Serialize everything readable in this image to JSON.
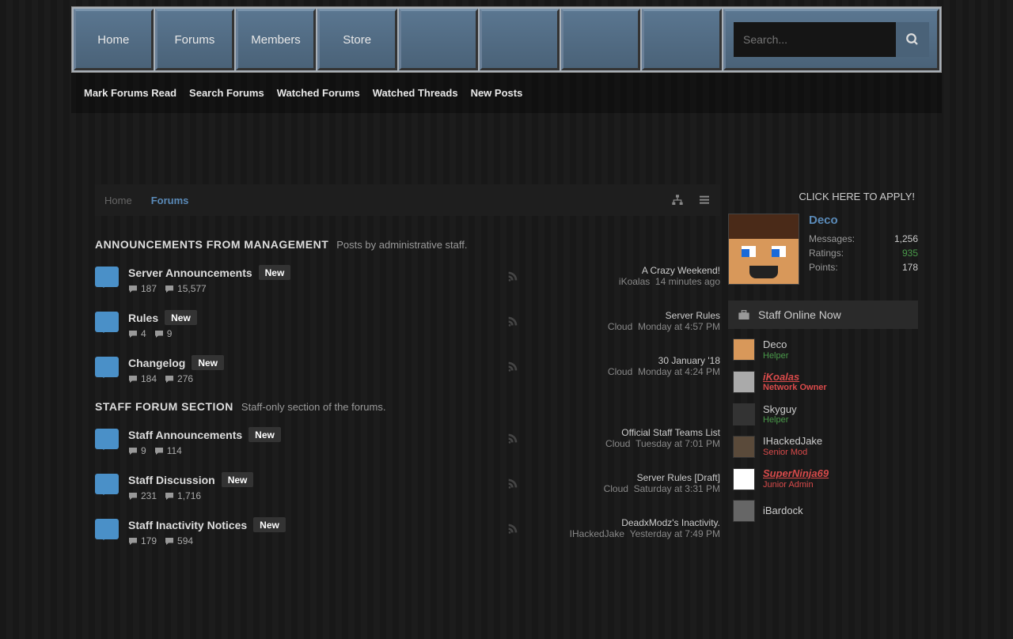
{
  "nav": {
    "items": [
      "Home",
      "Forums",
      "Members",
      "Store"
    ],
    "search_placeholder": "Search..."
  },
  "subnav": [
    "Mark Forums Read",
    "Search Forums",
    "Watched Forums",
    "Watched Threads",
    "New Posts"
  ],
  "breadcrumb": {
    "home": "Home",
    "current": "Forums"
  },
  "new_label": "New",
  "sections": [
    {
      "title": "ANNOUNCEMENTS FROM MANAGEMENT",
      "subtitle": "Posts by administrative staff.",
      "forums": [
        {
          "name": "Server Announcements",
          "threads": "187",
          "posts": "15,577",
          "latest_title": "A Crazy Weekend!",
          "latest_user": "iKoalas",
          "latest_time": "14 minutes ago"
        },
        {
          "name": "Rules",
          "threads": "4",
          "posts": "9",
          "latest_title": "Server Rules",
          "latest_user": "Cloud",
          "latest_time": "Monday at 4:57 PM"
        },
        {
          "name": "Changelog",
          "threads": "184",
          "posts": "276",
          "latest_title": "30 January '18",
          "latest_user": "Cloud",
          "latest_time": "Monday at 4:24 PM"
        }
      ]
    },
    {
      "title": "STAFF FORUM SECTION",
      "subtitle": "Staff-only section of the forums.",
      "forums": [
        {
          "name": "Staff Announcements",
          "threads": "9",
          "posts": "114",
          "latest_title": "Official Staff Teams List",
          "latest_user": "Cloud",
          "latest_time": "Tuesday at 7:01 PM"
        },
        {
          "name": "Staff Discussion",
          "threads": "231",
          "posts": "1,716",
          "latest_title": "Server Rules [Draft]",
          "latest_user": "Cloud",
          "latest_time": "Saturday at 3:31 PM"
        },
        {
          "name": "Staff Inactivity Notices",
          "threads": "179",
          "posts": "594",
          "latest_title": "DeadxModz's Inactivity.",
          "latest_user": "IHackedJake",
          "latest_time": "Yesterday at 7:49 PM"
        }
      ]
    }
  ],
  "sidebar": {
    "apply": "CLICK HERE TO APPLY!",
    "profile": {
      "name": "Deco",
      "stats": [
        {
          "label": "Messages:",
          "value": "1,256",
          "cls": ""
        },
        {
          "label": "Ratings:",
          "value": "935",
          "cls": "green"
        },
        {
          "label": "Points:",
          "value": "178",
          "cls": ""
        }
      ]
    },
    "staff_header": "Staff Online Now",
    "staff": [
      {
        "name": "Deco",
        "role": "Helper",
        "nameCls": "",
        "roleCls": "role-helper",
        "av": "#d8985a"
      },
      {
        "name": "iKoalas",
        "role": "Network Owner",
        "nameCls": "name-owner",
        "roleCls": "role-owner",
        "av": "#aaa"
      },
      {
        "name": "Skyguy",
        "role": "Helper",
        "nameCls": "",
        "roleCls": "role-helper",
        "av": "#333"
      },
      {
        "name": "IHackedJake",
        "role": "Senior Mod",
        "nameCls": "",
        "roleCls": "role-senior",
        "av": "#5a4a3a"
      },
      {
        "name": "SuperNinja69",
        "role": "Junior Admin",
        "nameCls": "name-admin",
        "roleCls": "role-junior",
        "av": "#fff"
      },
      {
        "name": "iBardock",
        "role": "",
        "nameCls": "",
        "roleCls": "",
        "av": "#666"
      }
    ]
  }
}
